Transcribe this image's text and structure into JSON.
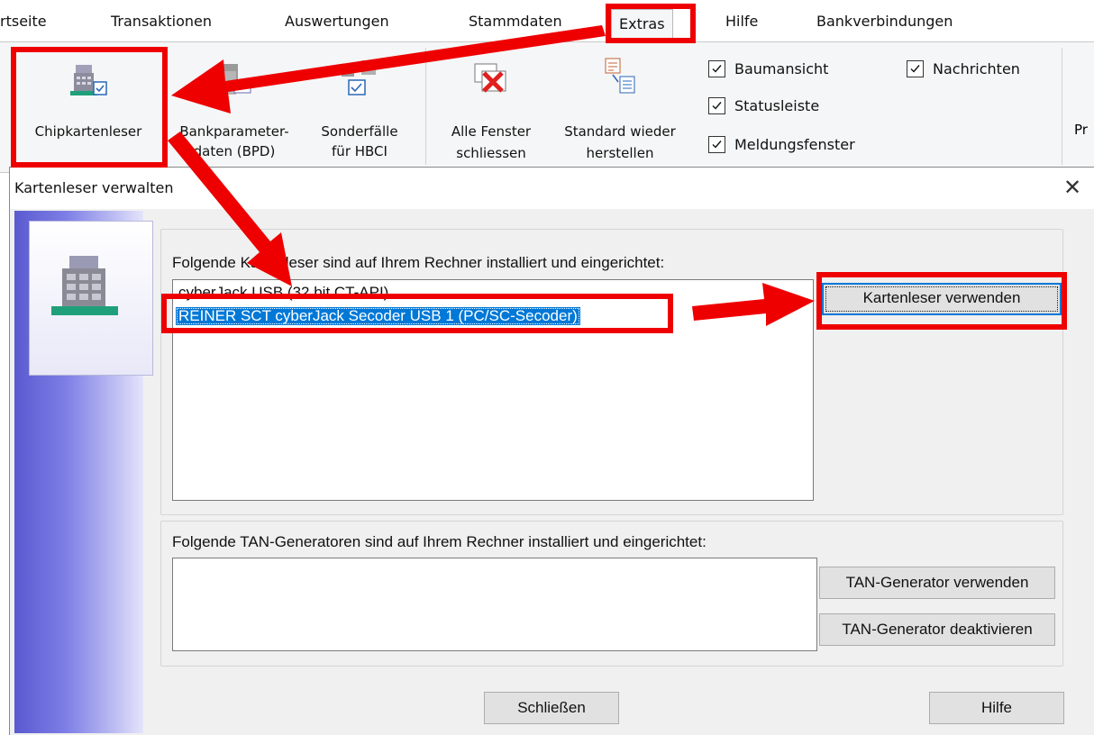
{
  "tabs": [
    {
      "label": "rtseite"
    },
    {
      "label": "Transaktionen"
    },
    {
      "label": "Auswertungen"
    },
    {
      "label": "Stammdaten"
    },
    {
      "label": "Extras"
    },
    {
      "label": "Hilfe"
    },
    {
      "label": "Bankverbindungen"
    }
  ],
  "ribbon": {
    "chip": "Chipkartenleser",
    "bpd_line1": "Bankparameter-",
    "bpd_line2": "daten (BPD)",
    "sonder_line1": "Sonderfälle",
    "sonder_line2": "für HBCI",
    "close_line1": "Alle Fenster",
    "close_line2": "schliessen",
    "restore_line1": "Standard wieder",
    "restore_line2": "herstellen",
    "checks": {
      "baum": "Baumansicht",
      "nachrichten": "Nachrichten",
      "status": "Statusleiste",
      "meldung": "Meldungsfenster"
    },
    "cut_label": "Pr"
  },
  "dialog": {
    "title": "Kartenleser verwalten",
    "close_glyph": "✕",
    "readers_label": "Folgende Kartenleser sind auf Ihrem Rechner installiert und eingerichtet:",
    "readers": [
      "cyberJack USB (32 bit CT-API)",
      "REINER SCT cyberJack Secoder USB 1 (PC/SC-Secoder)"
    ],
    "use_reader_button": "Kartenleser verwenden",
    "tan_label": "Folgende TAN-Generatoren sind auf Ihrem Rechner installiert und eingerichtet:",
    "tan_use_button": "TAN-Generator verwenden",
    "tan_deactivate_button": "TAN-Generator deaktivieren",
    "close_button": "Schließen",
    "help_button": "Hilfe"
  },
  "colors": {
    "annotation_red": "#ee0000",
    "selection_blue": "#0078d7"
  }
}
